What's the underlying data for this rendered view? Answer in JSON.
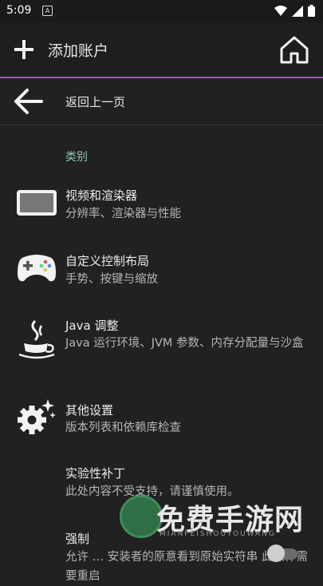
{
  "status_bar": {
    "time": "5:09",
    "notif_glyph": "A"
  },
  "toolbar": {
    "add_label": "添加账户"
  },
  "back": {
    "label": "返回上一页"
  },
  "category": "类别",
  "items": [
    {
      "icon": "tablet-icon",
      "title": "视频和渲染器",
      "subtitle": "分辨率、渲染器与性能"
    },
    {
      "icon": "gamepad-icon",
      "title": "自定义控制布局",
      "subtitle": "手势、按键与缩放"
    },
    {
      "icon": "java-cup-icon",
      "title": "Java 调整",
      "subtitle": "Java 运行环境、JVM 参数、内存分配量与沙盒"
    },
    {
      "icon": "gear-sparkle-icon",
      "title": "其他设置",
      "subtitle": "版本列表和依赖库检查"
    },
    {
      "icon": "",
      "title": "实验性补丁",
      "subtitle": "此处内容不受支持，请谨慎使用。"
    },
    {
      "icon": "",
      "title": "强制",
      "subtitle": "允许 … 安装者的原意看到原始实符串 此操作需要重启"
    }
  ],
  "watermark": {
    "text": "免费手游网",
    "sub": "MIANFEISHOUYOUWANG"
  },
  "colors": {
    "accent": "#9b59b6",
    "category": "#8fc9b0"
  }
}
